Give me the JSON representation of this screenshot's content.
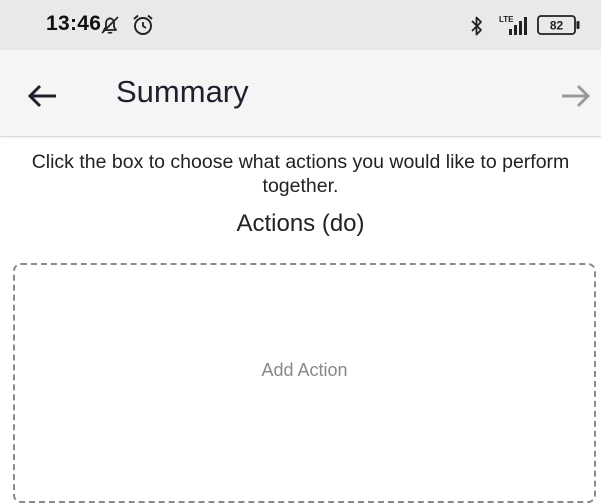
{
  "status_bar": {
    "time": "13:46",
    "left_icons": [
      "notifications-off-icon",
      "alarm-icon"
    ],
    "right_icons": [
      "bluetooth-icon",
      "lte-signal-icon",
      "battery-icon"
    ],
    "network_label": "LTE",
    "battery_level": "82"
  },
  "app_bar": {
    "back_icon": "arrow-left-icon",
    "title": "Summary",
    "next_icon": "arrow-right-icon"
  },
  "main": {
    "instructions": "Click the box to choose what actions you would like to perform together.",
    "section_heading": "Actions (do)",
    "add_action_label": "Add Action"
  },
  "colors": {
    "status_bar_bg": "#e9e9e9",
    "app_bar_bg": "#f5f5f5",
    "title_text": "#1f1f2e",
    "placeholder_text": "#888888",
    "dashed_border": "#8a8a8a",
    "next_arrow_disabled": "#9a9a9a"
  }
}
